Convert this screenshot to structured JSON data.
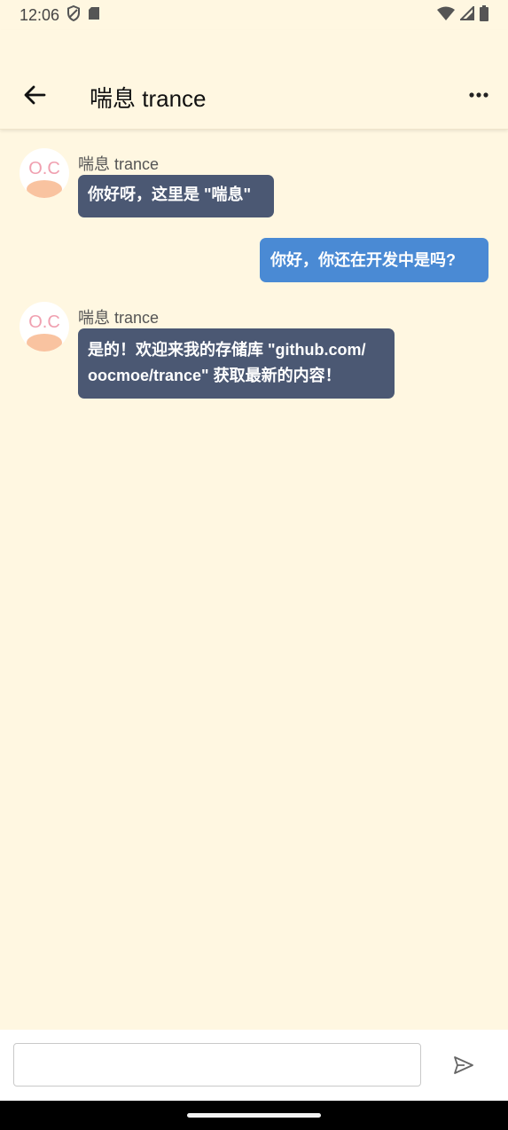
{
  "status_bar": {
    "time": "12:06"
  },
  "app_bar": {
    "title": "喘息 trance"
  },
  "messages": [
    {
      "role": "bot",
      "sender": "喘息 trance",
      "avatar_text": "O.C",
      "text": "你好呀，这里是 \"喘息\""
    },
    {
      "role": "user",
      "text": "你好，你还在开发中是吗?"
    },
    {
      "role": "bot",
      "sender": "喘息 trance",
      "avatar_text": "O.C",
      "text_line1": "是的！欢迎来我的存储库 \"github.com/",
      "text_line2": "oocmoe/trance\" 获取最新的内容！"
    }
  ],
  "input": {
    "value": "",
    "placeholder": ""
  },
  "colors": {
    "background": "#fff7e1",
    "bot_bubble": "#4b5873",
    "user_bubble": "#4a8ad4",
    "avatar_text": "#f0a0b0",
    "avatar_face": "#f9c3a0"
  },
  "icons": {
    "back": "arrow-left-icon",
    "more": "more-horizontal-icon",
    "send": "send-icon"
  }
}
